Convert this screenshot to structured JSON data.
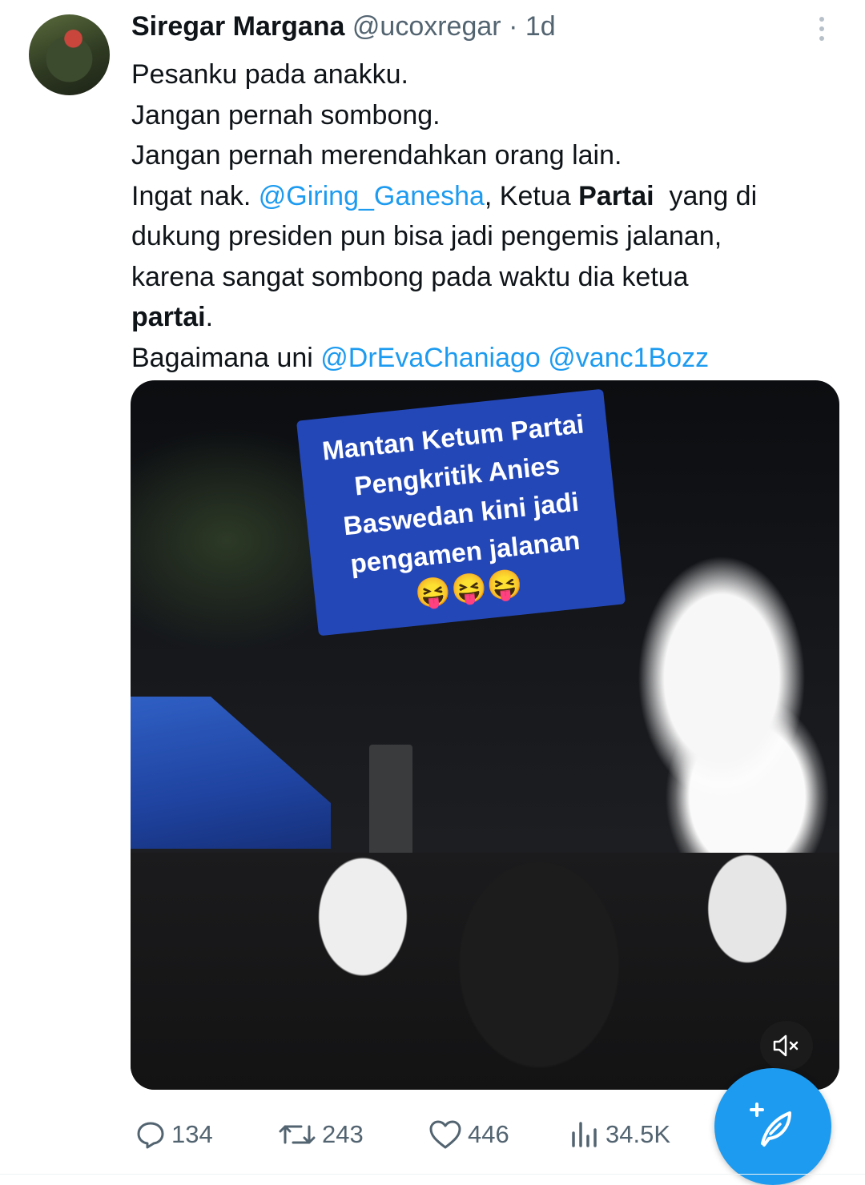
{
  "tweet": {
    "author_name": "Siregar Margana",
    "handle": "@ucoxregar",
    "separator": "·",
    "time": "1d",
    "lines": {
      "l1": "Pesanku pada anakku.",
      "l2": "Jangan pernah sombong.",
      "l3": "Jangan pernah merendahkan orang lain.",
      "l4_a": "Ingat nak. ",
      "l4_mention": "@Giring_Ganesha",
      "l4_b": ", Ketua ",
      "l4_bold": "Partai",
      "l4_c": "  yang di",
      "l5": "dukung presiden pun bisa jadi pengemis jalanan,",
      "l6": "karena sangat sombong pada waktu dia ketua",
      "l7_bold": "partai",
      "l7_c": ".",
      "l8_a": "Bagaimana uni ",
      "l8_mention1": "@DrEvaChaniago",
      "l8_space": " ",
      "l8_mention2": "@vanc1Bozz"
    }
  },
  "media": {
    "overlay_lines": [
      "Mantan Ketum Partai",
      "Pengkritik Anies",
      "Baswedan kini jadi",
      "pengamen jalanan"
    ],
    "overlay_emoji": "😝😝😝",
    "mute_icon": "speaker-muted-icon"
  },
  "actions": {
    "replies": "134",
    "reposts": "243",
    "likes": "446",
    "views": "34.5K"
  },
  "icons": {
    "reply": "reply-icon",
    "repost": "repost-icon",
    "like": "heart-icon",
    "views": "views-icon",
    "compose": "compose-feather-icon",
    "more": "more-vertical-icon"
  },
  "colors": {
    "accent": "#1d9bf0",
    "secondary_text": "#536471",
    "overlay_bg": "#2447b8"
  }
}
